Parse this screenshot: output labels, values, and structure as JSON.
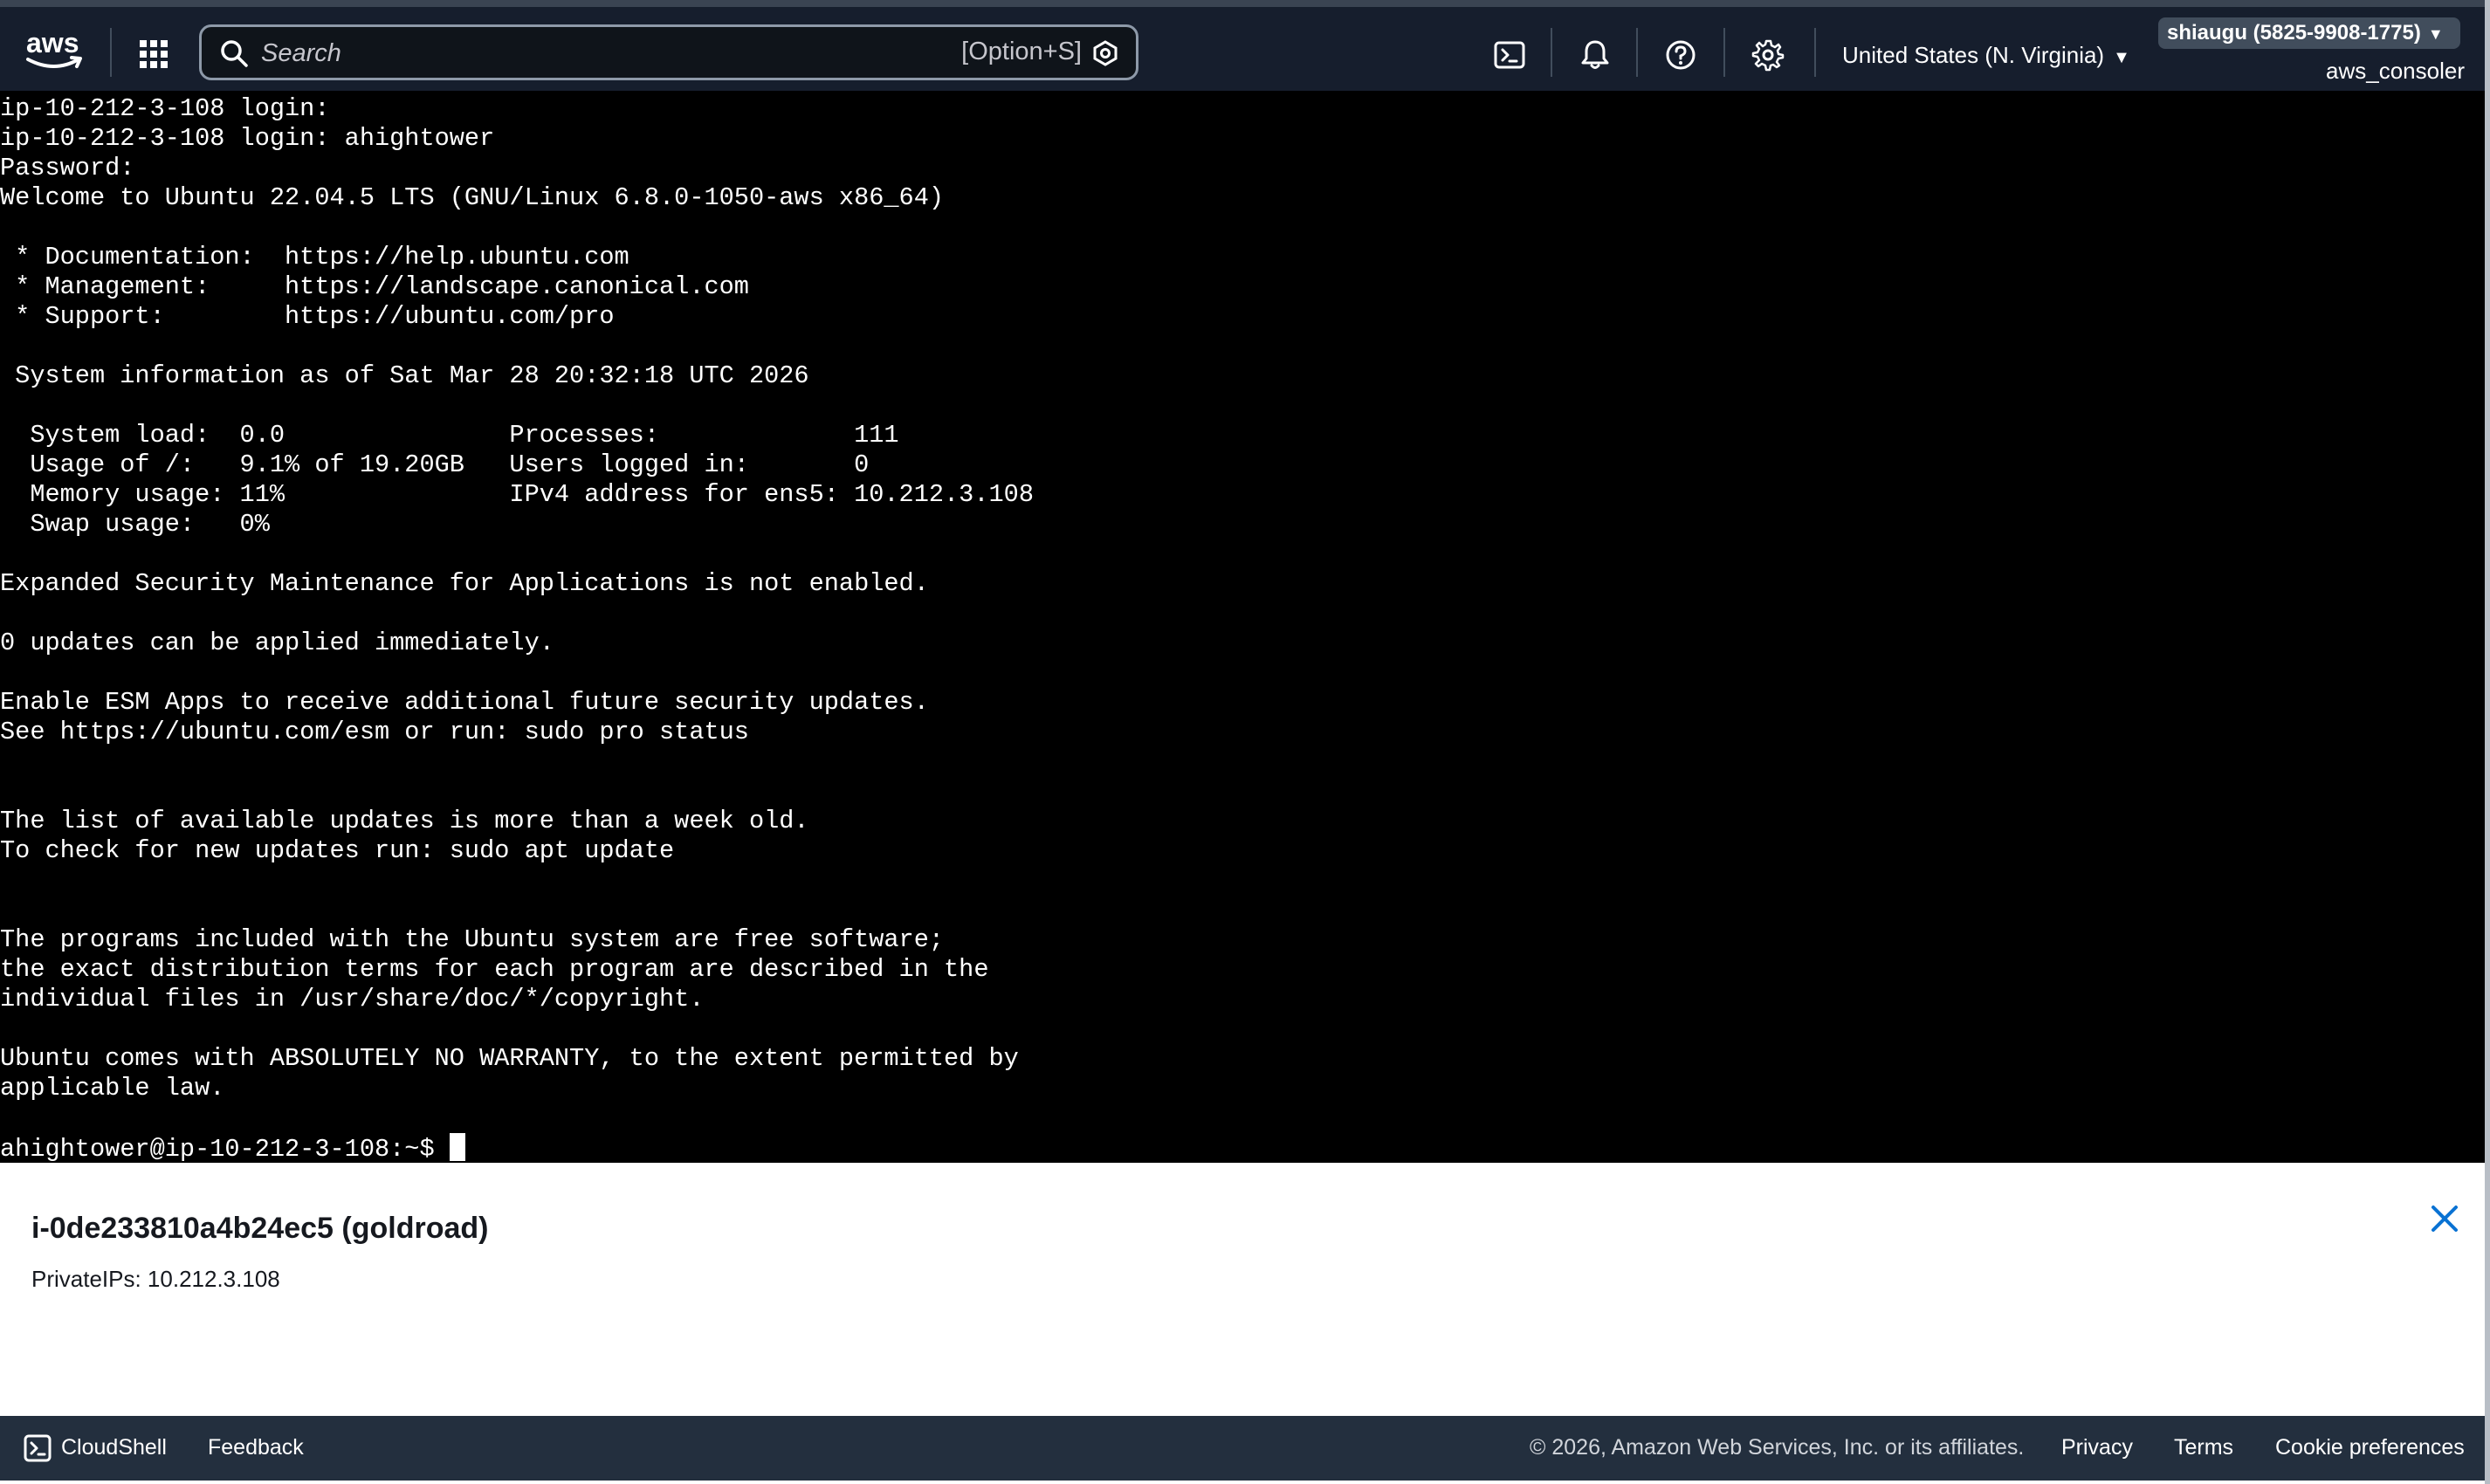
{
  "colors": {
    "topbar_bg": "#161e2d",
    "terminal_bg": "#000000",
    "terminal_fg": "#ffffff",
    "footer_bg": "#232f3e",
    "link_blue": "#0972d3"
  },
  "topbar": {
    "logo_text": "aws",
    "search_placeholder": "Search",
    "search_shortcut": "[Option+S]",
    "icons": [
      "cloudshell-icon",
      "bell-icon",
      "help-icon",
      "gear-icon"
    ],
    "region": "United States (N. Virginia)",
    "account": "shiaugu (5825-9908-1775)",
    "user": "aws_consoler"
  },
  "terminal": {
    "lines": [
      "ip-10-212-3-108 login:",
      "ip-10-212-3-108 login: ahightower",
      "Password:",
      "Welcome to Ubuntu 22.04.5 LTS (GNU/Linux 6.8.0-1050-aws x86_64)",
      "",
      " * Documentation:  https://help.ubuntu.com",
      " * Management:     https://landscape.canonical.com",
      " * Support:        https://ubuntu.com/pro",
      "",
      " System information as of Sat Mar 28 20:32:18 UTC 2026",
      "",
      "  System load:  0.0               Processes:             111",
      "  Usage of /:   9.1% of 19.20GB   Users logged in:       0",
      "  Memory usage: 11%               IPv4 address for ens5: 10.212.3.108",
      "  Swap usage:   0%",
      "",
      "Expanded Security Maintenance for Applications is not enabled.",
      "",
      "0 updates can be applied immediately.",
      "",
      "Enable ESM Apps to receive additional future security updates.",
      "See https://ubuntu.com/esm or run: sudo pro status",
      "",
      "",
      "The list of available updates is more than a week old.",
      "To check for new updates run: sudo apt update",
      "",
      "",
      "The programs included with the Ubuntu system are free software;",
      "the exact distribution terms for each program are described in the",
      "individual files in /usr/share/doc/*/copyright.",
      "",
      "Ubuntu comes with ABSOLUTELY NO WARRANTY, to the extent permitted by",
      "applicable law.",
      ""
    ],
    "prompt": "ahightower@ip-10-212-3-108:~$ "
  },
  "instance": {
    "title": "i-0de233810a4b24ec5 (goldroad)",
    "private_ips": "PrivateIPs: 10.212.3.108"
  },
  "footer": {
    "cloudshell": "CloudShell",
    "feedback": "Feedback",
    "copyright": "© 2026, Amazon Web Services, Inc. or its affiliates.",
    "privacy": "Privacy",
    "terms": "Terms",
    "cookies": "Cookie preferences"
  }
}
